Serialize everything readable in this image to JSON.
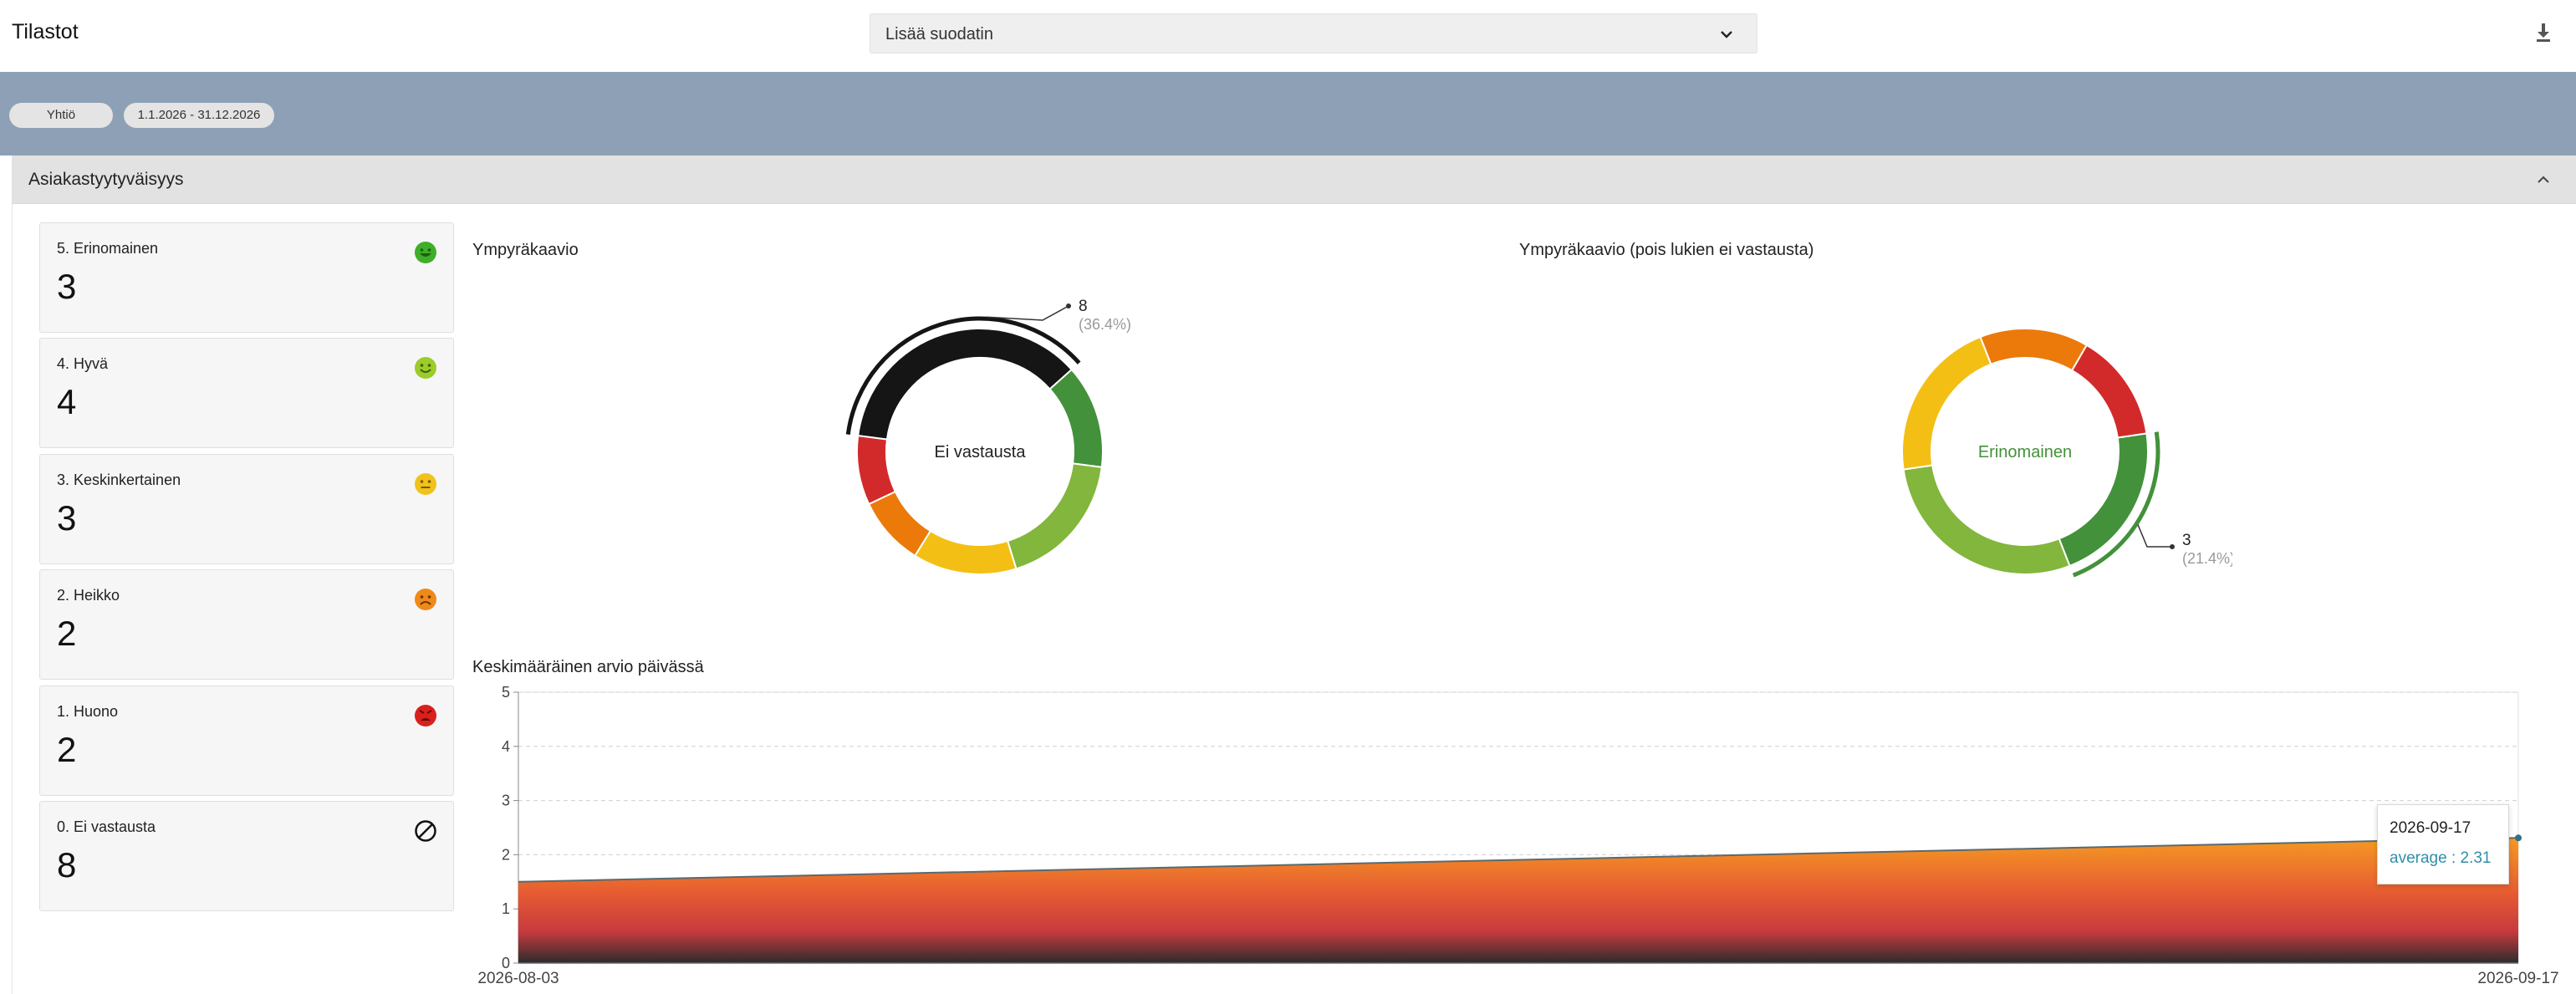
{
  "header": {
    "title": "Tilastot",
    "filter_placeholder": "Lisää suodatin",
    "download_icon": "download-icon"
  },
  "filters": {
    "chips": [
      "Yhtiö",
      "1.1.2026 - 31.12.2026"
    ]
  },
  "section": {
    "title": "Asiakastyytyväisyys",
    "collapse_icon": "chevron-up-icon"
  },
  "cards": [
    {
      "label": "5. Erinomainen",
      "value": "3",
      "icon": "very-happy-face-icon",
      "color": "#3fae28"
    },
    {
      "label": "4. Hyvä",
      "value": "4",
      "icon": "happy-face-icon",
      "color": "#9ccc2a"
    },
    {
      "label": "3. Keskinkertainen",
      "value": "3",
      "icon": "neutral-face-icon",
      "color": "#f1c21b"
    },
    {
      "label": "2. Heikko",
      "value": "2",
      "icon": "sad-face-icon",
      "color": "#ee8a1c"
    },
    {
      "label": "1. Huono",
      "value": "2",
      "icon": "angry-face-icon",
      "color": "#d9201c"
    },
    {
      "label": "0. Ei vastausta",
      "value": "8",
      "icon": "no-answer-icon",
      "color": "#111111"
    }
  ],
  "chart_data": [
    {
      "type": "pie",
      "title": "Ympyräkaavio",
      "center_label": "Ei vastausta",
      "highlight": {
        "label": "Ei vastausta",
        "value": "8",
        "percent": "(36.4%)"
      },
      "slices": [
        {
          "label": "Ei vastausta",
          "value": 8,
          "color": "#151515"
        },
        {
          "label": "Erinomainen",
          "value": 3,
          "color": "#43913a"
        },
        {
          "label": "Hyvä",
          "value": 4,
          "color": "#82b63c"
        },
        {
          "label": "Keskinkertainen",
          "value": 3,
          "color": "#f4bf14"
        },
        {
          "label": "Heikko",
          "value": 2,
          "color": "#eb7a0b"
        },
        {
          "label": "Huono",
          "value": 2,
          "color": "#d22a2a"
        }
      ]
    },
    {
      "type": "pie",
      "title": "Ympyräkaavio (pois lukien ei vastausta)",
      "center_label": "Erinomainen",
      "highlight": {
        "label": "Erinomainen",
        "value": "3",
        "percent": "(21.4%)"
      },
      "slices": [
        {
          "label": "Erinomainen",
          "value": 3,
          "color": "#43913a"
        },
        {
          "label": "Hyvä",
          "value": 4,
          "color": "#82b63c"
        },
        {
          "label": "Keskinkertainen",
          "value": 3,
          "color": "#f4bf14"
        },
        {
          "label": "Heikko",
          "value": 2,
          "color": "#eb7a0b"
        },
        {
          "label": "Huono",
          "value": 2,
          "color": "#d22a2a"
        }
      ]
    },
    {
      "type": "area",
      "title": "Keskimääräinen arvio päivässä",
      "x": [
        "2026-08-03",
        "2026-09-17"
      ],
      "series": [
        {
          "name": "average",
          "values": [
            1.5,
            2.31
          ]
        }
      ],
      "ylim": [
        0,
        5
      ],
      "yticks": [
        "0",
        "1",
        "2",
        "3",
        "4",
        "5"
      ],
      "xticks": [
        "2026-08-03",
        "2026-09-17"
      ],
      "grid": true,
      "tooltip": {
        "date": "2026-09-17",
        "text": "average : 2.31"
      }
    }
  ]
}
